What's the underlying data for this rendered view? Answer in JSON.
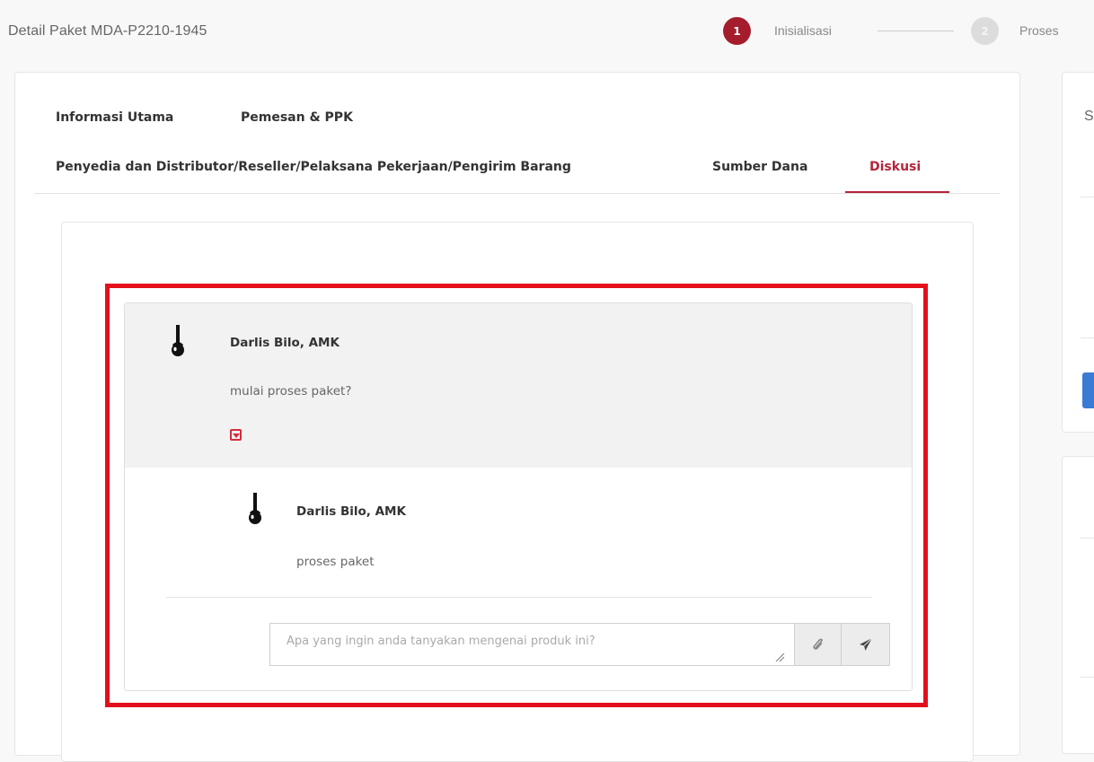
{
  "header": {
    "title": "Detail Paket MDA-P2210-1945"
  },
  "stepper": {
    "steps": [
      {
        "number": "1",
        "label": "Inisialisasi",
        "state": "active"
      },
      {
        "number": "2",
        "label": "Proses",
        "state": "inactive"
      }
    ]
  },
  "tabs": [
    {
      "label": "Informasi Utama"
    },
    {
      "label": "Pemesan & PPK"
    },
    {
      "label": "Penyedia dan Distributor/Reseller/Pelaksana Pekerjaan/Pengirim Barang"
    },
    {
      "label": "Sumber Dana"
    },
    {
      "label": "Diskusi",
      "active": true
    }
  ],
  "sidebar": {
    "partial_label": "S"
  },
  "discussion": {
    "message": {
      "author": "Darlis Bilo, AMK",
      "text": "mulai proses paket?",
      "toggle_icon": "caret-square-down-icon"
    },
    "reply": {
      "author": "Darlis Bilo, AMK",
      "text": "proses paket"
    },
    "composer": {
      "placeholder": "Apa yang ingin anda tanyakan mengenai produk ini?",
      "attach_icon": "paperclip-icon",
      "send_icon": "paper-plane-icon"
    }
  },
  "colors": {
    "accent": "#a51d2d",
    "highlight_border": "#e3101c",
    "active_tab": "#b5243a",
    "inactive_step": "#dcdcdc"
  }
}
